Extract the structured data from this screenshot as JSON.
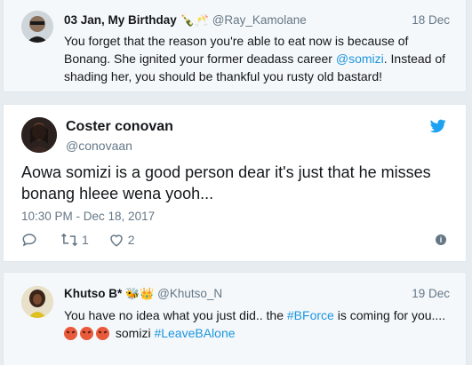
{
  "reply_top": {
    "display_name": "03 Jan, My Birthday",
    "name_emojis": "🍾🥂",
    "handle": "@Ray_Kamolane",
    "date": "18 Dec",
    "text_before_link": "You forget that the reason you're able to eat now is because of Bonang. She ignited your former deadass career ",
    "link_mention": "@somizi",
    "text_after_link": ". Instead of shading her, you should be thankful you rusty old bastard!"
  },
  "main_tweet": {
    "display_name": "Coster conovan",
    "handle": "@conovaan",
    "text": "Aowa somizi is a good person dear it's just that he misses bonang hleee wena yooh...",
    "timestamp": "10:30 PM - Dec 18, 2017",
    "retweet_count": "1",
    "like_count": "2",
    "brand_color": "#1da1f2"
  },
  "reply_bottom": {
    "display_name": "Khutso B*",
    "name_emojis": "🐝👑",
    "handle": "@Khutso_N",
    "date": "19 Dec",
    "text_part1": "You have no idea what you just did.. the ",
    "hashtag1": "#BForce",
    "text_part2": " is coming for you.... ",
    "text_part3": " somizi ",
    "hashtag2": "#LeaveBAlone"
  }
}
